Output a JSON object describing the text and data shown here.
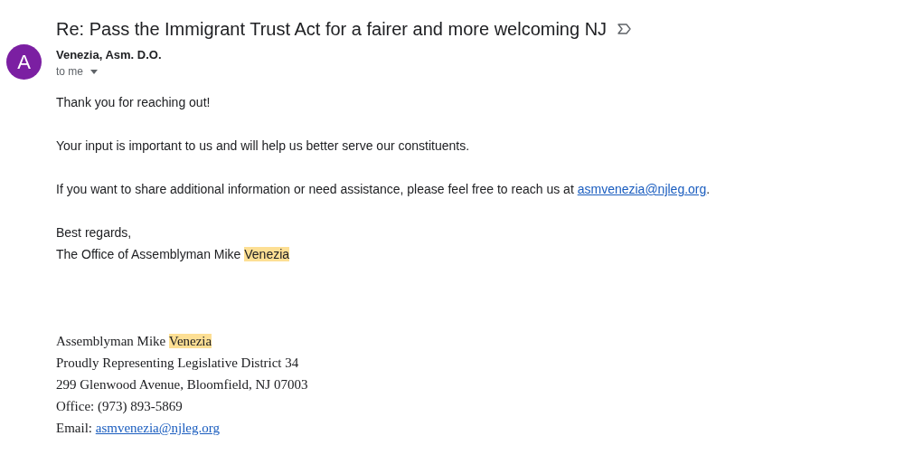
{
  "subject": "Re: Pass the Immigrant Trust Act for a fairer and more welcoming NJ",
  "sender": {
    "avatar_letter": "A",
    "name": "Venezia, Asm. D.O.",
    "recipient": "to me"
  },
  "body": [
    {
      "lines": [
        [
          {
            "kind": "text",
            "text": "Thank you for reaching out!"
          }
        ]
      ]
    },
    {
      "lines": [
        [
          {
            "kind": "text",
            "text": "Your input is important to us and will help us better serve our constituents."
          }
        ]
      ]
    },
    {
      "lines": [
        [
          {
            "kind": "text",
            "text": "If you want to share additional information or need assistance, please feel free to reach us at "
          },
          {
            "kind": "link",
            "text": "asmvenezia@njleg.org"
          },
          {
            "kind": "text",
            "text": "."
          }
        ]
      ]
    },
    {
      "lines": [
        [
          {
            "kind": "text",
            "text": "Best regards,"
          }
        ],
        [
          {
            "kind": "text",
            "text": "The Office of Assemblyman Mike "
          },
          {
            "kind": "highlight",
            "text": "Venezia"
          }
        ]
      ]
    }
  ],
  "signature": [
    [
      {
        "kind": "text",
        "text": "Assemblyman Mike "
      },
      {
        "kind": "highlight",
        "text": "Venezia"
      }
    ],
    [
      {
        "kind": "text",
        "text": "Proudly Representing Legislative District 34"
      }
    ],
    [
      {
        "kind": "text",
        "text": "299 Glenwood Avenue, Bloomfield, NJ 07003"
      }
    ],
    [
      {
        "kind": "text",
        "text": "Office: (973) 893-5869"
      }
    ],
    [
      {
        "kind": "text",
        "text": "Email: "
      },
      {
        "kind": "link",
        "text": "asmvenezia@njleg.org"
      }
    ]
  ]
}
